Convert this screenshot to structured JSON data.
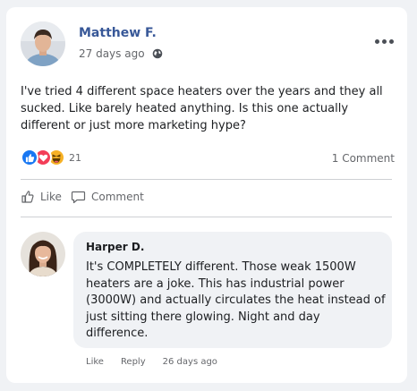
{
  "post": {
    "author": "Matthew F.",
    "time": "27 days ago",
    "text": "I've tried 4 different space heaters over the years and they all sucked. Like barely heated anything. Is this one actually different or just more marketing hype?",
    "reaction_count": "21",
    "comment_count": "1 Comment",
    "reactions": [
      "like-icon",
      "love-icon",
      "haha-icon"
    ]
  },
  "actions": {
    "like_label": "Like",
    "comment_label": "Comment"
  },
  "comment": {
    "author": "Harper D.",
    "text": "It's COMPLETELY different. Those weak 1500W heaters are a joke. This has industrial power (3000W) and actually circulates the heat instead of just sitting there glowing. Night and day difference.",
    "like_label": "Like",
    "reply_label": "Reply",
    "time": "26 days ago"
  },
  "colors": {
    "author_name": "#385898",
    "like_blue": "#1877f2",
    "love_red": "#f33e58",
    "haha_yellow": "#f7b125"
  }
}
